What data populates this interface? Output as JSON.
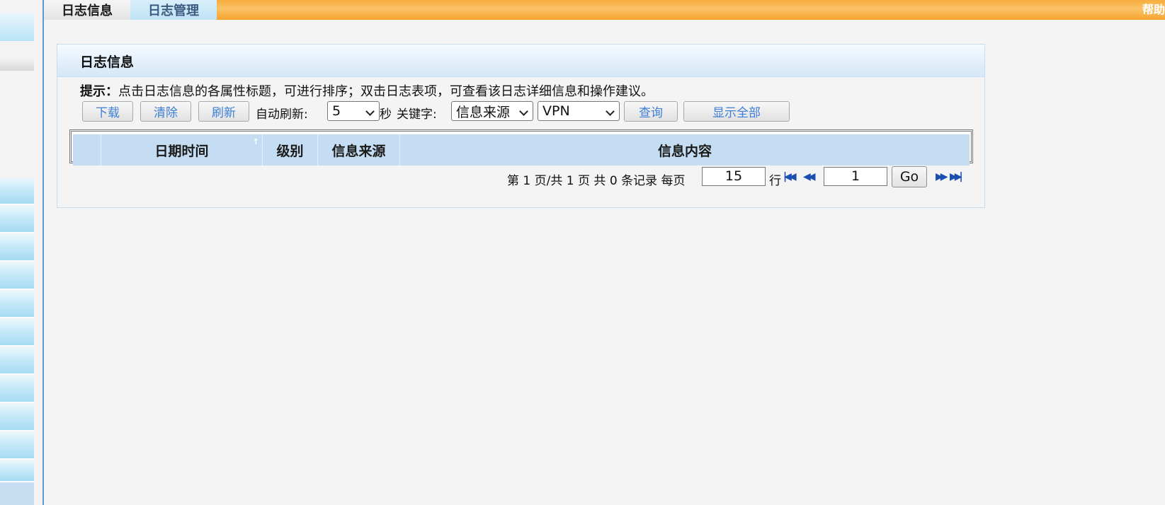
{
  "tabs": {
    "log_info": "日志信息",
    "log_manage": "日志管理"
  },
  "help_label": "帮助",
  "panel": {
    "title": "日志信息",
    "tip_prefix": "提示：",
    "tip_text": "点击日志信息的各属性标题，可进行排序；双击日志表项，可查看该日志详细信息和操作建议。"
  },
  "toolbar": {
    "download": "下载",
    "clear": "清除",
    "refresh": "刷新",
    "auto_refresh_label": "自动刷新:",
    "auto_refresh_value": "5",
    "seconds_label": "秒",
    "keyword_label": "关键字:",
    "field_select_value": "信息来源",
    "keyword_select_value": "VPN",
    "query": "查询",
    "show_all": "显示全部"
  },
  "table": {
    "columns": [
      "",
      "日期时间",
      "级别",
      "信息来源",
      "信息内容"
    ],
    "rows": []
  },
  "pager": {
    "page_prefix": "第",
    "current_page": "1",
    "page_mid": "页/共",
    "total_pages": "1",
    "page_suffix": "页 共",
    "total_records": "0",
    "records_suffix": "条记录 每页",
    "rows_per_page": "15",
    "rows_suffix": "行",
    "goto_page": "1",
    "go": "Go"
  },
  "colors": {
    "top_bar": "#f6ad3c",
    "header_blue": "#c5ddf2",
    "button_text": "#3d7fd6",
    "pager_icons": "#1a4fb0"
  }
}
